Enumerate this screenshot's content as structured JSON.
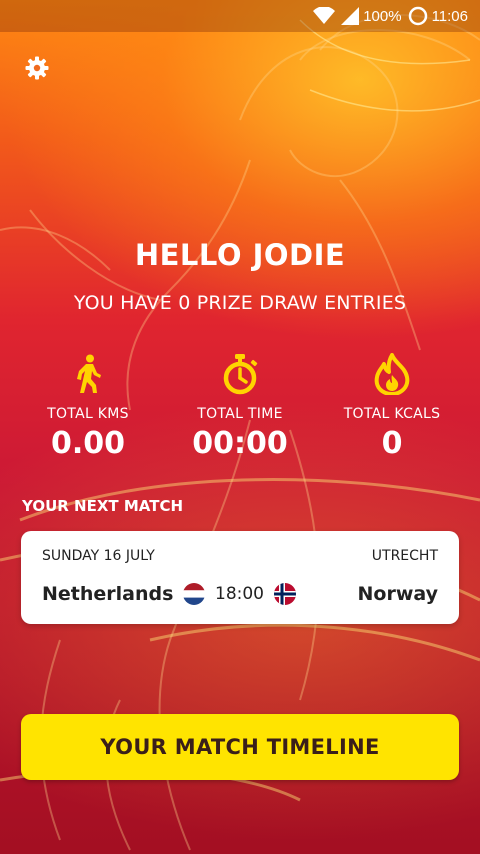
{
  "status_bar": {
    "battery": "100%",
    "time": "11:06"
  },
  "icons": {
    "settings": "gear-icon",
    "distance": "walking-person-icon",
    "time": "stopwatch-icon",
    "kcals": "flame-icon"
  },
  "home": {
    "greeting": "HELLO JODIE",
    "entries": "YOU HAVE 0 PRIZE DRAW ENTRIES"
  },
  "stats": [
    {
      "label": "TOTAL KMS",
      "value": "0.00"
    },
    {
      "label": "TOTAL TIME",
      "value": "00:00"
    },
    {
      "label": "TOTAL KCALS",
      "value": "0"
    }
  ],
  "next_match": {
    "title": "YOUR NEXT MATCH",
    "date": "SUNDAY 16 JULY",
    "venue": "UTRECHT",
    "home_team": "Netherlands",
    "away_team": "Norway",
    "kickoff": "18:00"
  },
  "timeline_button": {
    "label": "YOUR MATCH TIMELINE"
  },
  "colors": {
    "accent_yellow": "#ffe400",
    "icon_yellow": "#ffd400",
    "background_red": "#c81a32",
    "background_orange": "#ff8a12"
  }
}
